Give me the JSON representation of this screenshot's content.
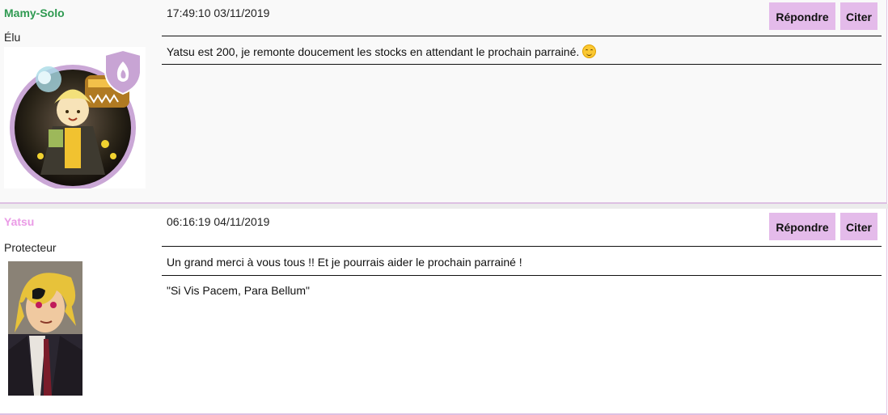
{
  "posts": [
    {
      "author": "Mamy-Solo",
      "rank": "Élu",
      "timestamp": "17:49:10 03/11/2019",
      "reply_label": "Répondre",
      "quote_label": "Citer",
      "message": "Yatsu est 200, je remonte doucement les stocks en attendant le prochain parrainé.",
      "emoji": "smiling-face-icon",
      "author_color": "#2f9a51"
    },
    {
      "author": "Yatsu",
      "rank": "Protecteur",
      "timestamp": "06:16:19 04/11/2019",
      "reply_label": "Répondre",
      "quote_label": "Citer",
      "message": "Un grand merci à vous tous !! Et je pourrais aider le prochain parrainé !",
      "signature": "\"Si Vis Pacem, Para Bellum\"",
      "author_color": "#ea9be6"
    }
  ],
  "colors": {
    "button_bg": "#e4bbea",
    "post_border": "#ddc0e2"
  }
}
